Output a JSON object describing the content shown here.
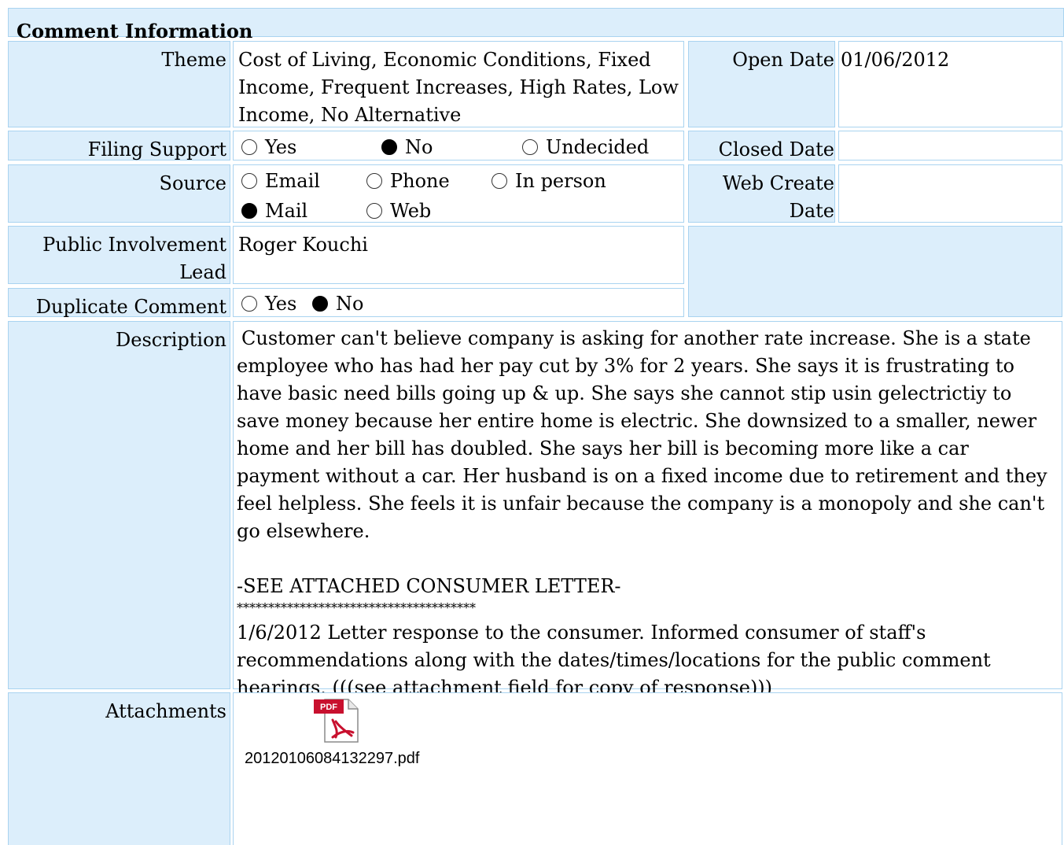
{
  "header": {
    "title": "Comment Information"
  },
  "theme": {
    "label": "Theme",
    "value": "Cost of Living, Economic Conditions, Fixed Income, Frequent Increases, High Rates, Low Income, No Alternative"
  },
  "open_date": {
    "label": "Open Date",
    "value": "01/06/2012"
  },
  "filing_support": {
    "label": "Filing Support",
    "options": [
      "Yes",
      "No",
      "Undecided"
    ],
    "selected": "No"
  },
  "closed_date": {
    "label": "Closed Date",
    "value": ""
  },
  "source": {
    "label": "Source",
    "options": [
      "Email",
      "Phone",
      "In person",
      "Mail",
      "Web"
    ],
    "selected": "Mail"
  },
  "web_create_date": {
    "label": "Web Create Date",
    "value": ""
  },
  "public_involvement_lead": {
    "label": "Public Involvement Lead",
    "value": "Roger Kouchi"
  },
  "duplicate_comment": {
    "label": "Duplicate Comment",
    "options": [
      "Yes",
      "No"
    ],
    "selected": "No"
  },
  "description": {
    "label": "Description",
    "paragraph1": "Customer can't believe company is asking for another rate increase. She is a state employee who has had her pay cut by 3% for 2 years. She says it is frustrating to have basic need bills going up & up. She says she cannot stip usin gelectrictiy to save money because her entire home is electric. She downsized to a smaller, newer home and her bill has doubled. She says her bill is becoming more like a car payment without a car. Her husband is on a fixed income due to retirement and they feel helpless. She feels it is unfair because the company is a monopoly and she can't go elsewhere.",
    "attached_note": "-SEE ATTACHED CONSUMER LETTER-",
    "separator": "**************************************",
    "paragraph2": "1/6/2012 Letter response to the consumer. Informed consumer of staff's recommendations along with the dates/times/locations for the public comment hearings. (((see attachment field for copy of response)))"
  },
  "attachments": {
    "label": "Attachments",
    "files": [
      {
        "name": "20120106084132297.pdf",
        "icon": "pdf-file-icon",
        "icon_text": "PDF"
      }
    ]
  },
  "colors": {
    "label_bg": "#dceefb",
    "border": "#a9d3f0",
    "pdf_red": "#c8102e"
  }
}
